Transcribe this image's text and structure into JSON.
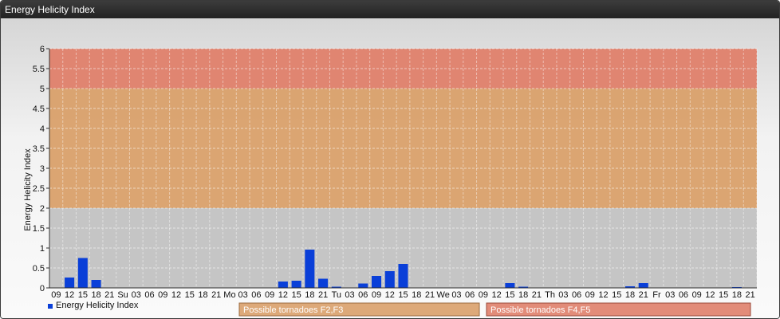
{
  "window": {
    "title": "Energy Helicity Index"
  },
  "chart_data": {
    "type": "bar",
    "ylabel": "Energy Helicity Index",
    "ylim": [
      0,
      6
    ],
    "yticks": [
      "0",
      "0.5",
      "1",
      "1.5",
      "2",
      "2.5",
      "3",
      "3.5",
      "4",
      "4.5",
      "5",
      "5.5",
      "6"
    ],
    "grid": true,
    "zones": [
      {
        "from": 0,
        "to": 2,
        "color": "#c2c2c2"
      },
      {
        "from": 2,
        "to": 5,
        "color": "#d9a06a"
      },
      {
        "from": 5,
        "to": 6,
        "color": "#df7f6a"
      }
    ],
    "categories": [
      "09",
      "12",
      "15",
      "18",
      "21",
      "Su",
      "03",
      "06",
      "09",
      "12",
      "15",
      "18",
      "21",
      "Mo",
      "03",
      "06",
      "09",
      "12",
      "15",
      "18",
      "21",
      "Tu",
      "03",
      "06",
      "09",
      "12",
      "15",
      "18",
      "21",
      "We",
      "03",
      "06",
      "09",
      "12",
      "15",
      "18",
      "21",
      "Th",
      "03",
      "06",
      "09",
      "12",
      "15",
      "18",
      "21",
      "Fr",
      "03",
      "06",
      "09",
      "12",
      "15",
      "18",
      "21"
    ],
    "series": [
      {
        "name": "Energy Helicity Index",
        "color": "#0a3fd8",
        "values": [
          0.01,
          0.26,
          0.75,
          0.2,
          0.01,
          0.01,
          0.01,
          0.01,
          0.01,
          0.01,
          0.01,
          0.01,
          0.01,
          0.01,
          0.01,
          0.01,
          0.01,
          0.16,
          0.18,
          0.96,
          0.23,
          0.03,
          0.01,
          0.11,
          0.3,
          0.42,
          0.6,
          0.01,
          0.01,
          0.01,
          0.01,
          0.01,
          0.01,
          0.01,
          0.12,
          0.03,
          0.01,
          0.01,
          0.01,
          0.01,
          0.01,
          0.01,
          0.01,
          0.04,
          0.12,
          0.01,
          0.01,
          0.01,
          0.01,
          0.01,
          0.01,
          0.02,
          0.01
        ]
      }
    ],
    "legend_position": "bottom-left",
    "annotations": [
      {
        "label": "Possible tornadoes F2,F3",
        "color": "#d9a06a"
      },
      {
        "label": "Possible tornadoes F4,F5",
        "color": "#df7f6a"
      }
    ]
  }
}
